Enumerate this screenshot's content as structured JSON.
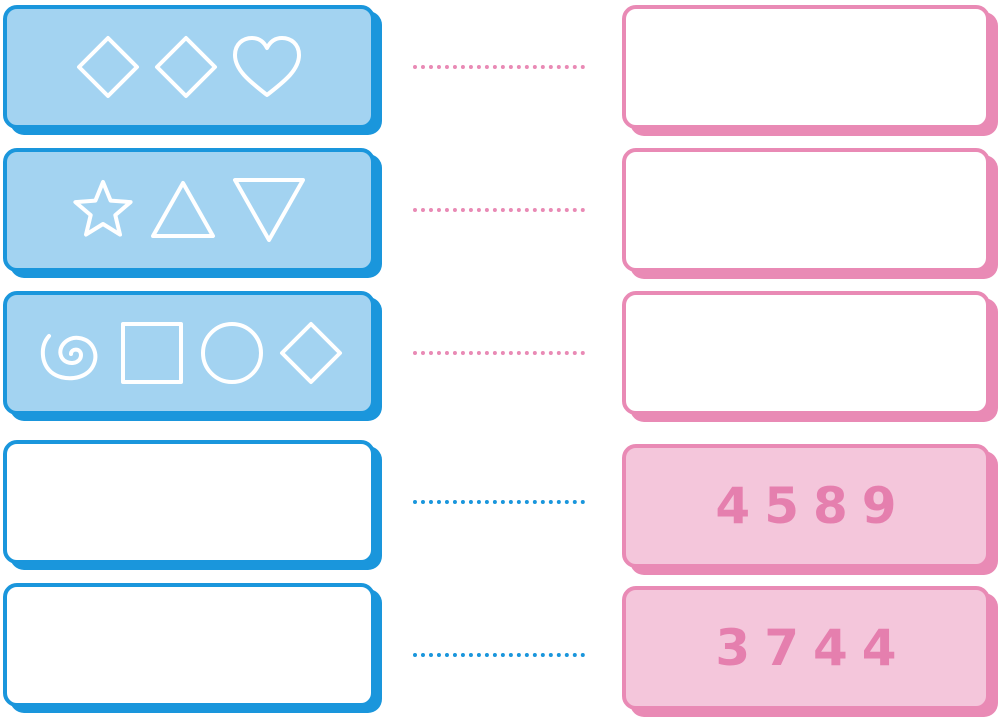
{
  "rows": [
    {
      "left": {
        "type": "symbols",
        "symbols": [
          "diamond-icon",
          "diamond-icon",
          "heart-icon"
        ]
      },
      "right": {
        "code": ""
      },
      "connector_color": "#e98ab5"
    },
    {
      "left": {
        "type": "symbols",
        "symbols": [
          "star-icon",
          "triangle-icon",
          "down-triangle-icon"
        ]
      },
      "right": {
        "code": ""
      },
      "connector_color": "#e98ab5"
    },
    {
      "left": {
        "type": "symbols",
        "symbols": [
          "spiral-icon",
          "square-icon",
          "circle-icon",
          "diamond-icon"
        ]
      },
      "right": {
        "code": ""
      },
      "connector_color": "#e98ab5"
    },
    {
      "left": {
        "type": "empty"
      },
      "right": {
        "code": "4589"
      },
      "connector_color": "#1a96dc"
    },
    {
      "left": {
        "type": "empty"
      },
      "right": {
        "code": "3744"
      },
      "connector_color": "#1a96dc"
    }
  ],
  "colors": {
    "blue_border": "#1a96dc",
    "blue_fill": "#a3d3f1",
    "pink_border": "#e98ab5",
    "pink_fill": "#f4c6db",
    "code_text": "#e57fae"
  }
}
